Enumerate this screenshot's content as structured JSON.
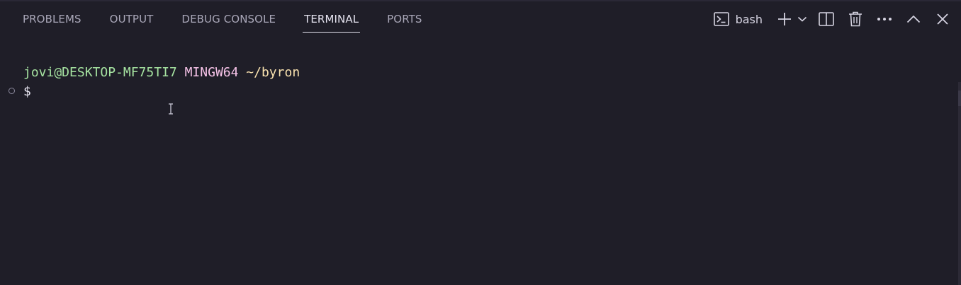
{
  "panel": {
    "tabs": [
      {
        "label": "PROBLEMS",
        "active": false
      },
      {
        "label": "OUTPUT",
        "active": false
      },
      {
        "label": "DEBUG CONSOLE",
        "active": false
      },
      {
        "label": "TERMINAL",
        "active": true
      },
      {
        "label": "PORTS",
        "active": false
      }
    ]
  },
  "toolbar": {
    "profile_label": "bash",
    "icons": [
      "terminal-icon",
      "add-icon",
      "chevron-down-icon",
      "split-icon",
      "trash-icon",
      "more-icon",
      "maximize-chevron-up-icon",
      "close-icon"
    ]
  },
  "terminal": {
    "user_host": "jovi@DESKTOP-MF75TI7",
    "system": "MINGW64",
    "cwd": "~/byron",
    "prompt": "$"
  },
  "colors": {
    "background": "#1f1e28",
    "user_host": "#a6e3a1",
    "system": "#f5c2e7",
    "cwd": "#f9e2af",
    "tab_text": "#a9a7b8",
    "tab_active": "#e6e4f0"
  }
}
